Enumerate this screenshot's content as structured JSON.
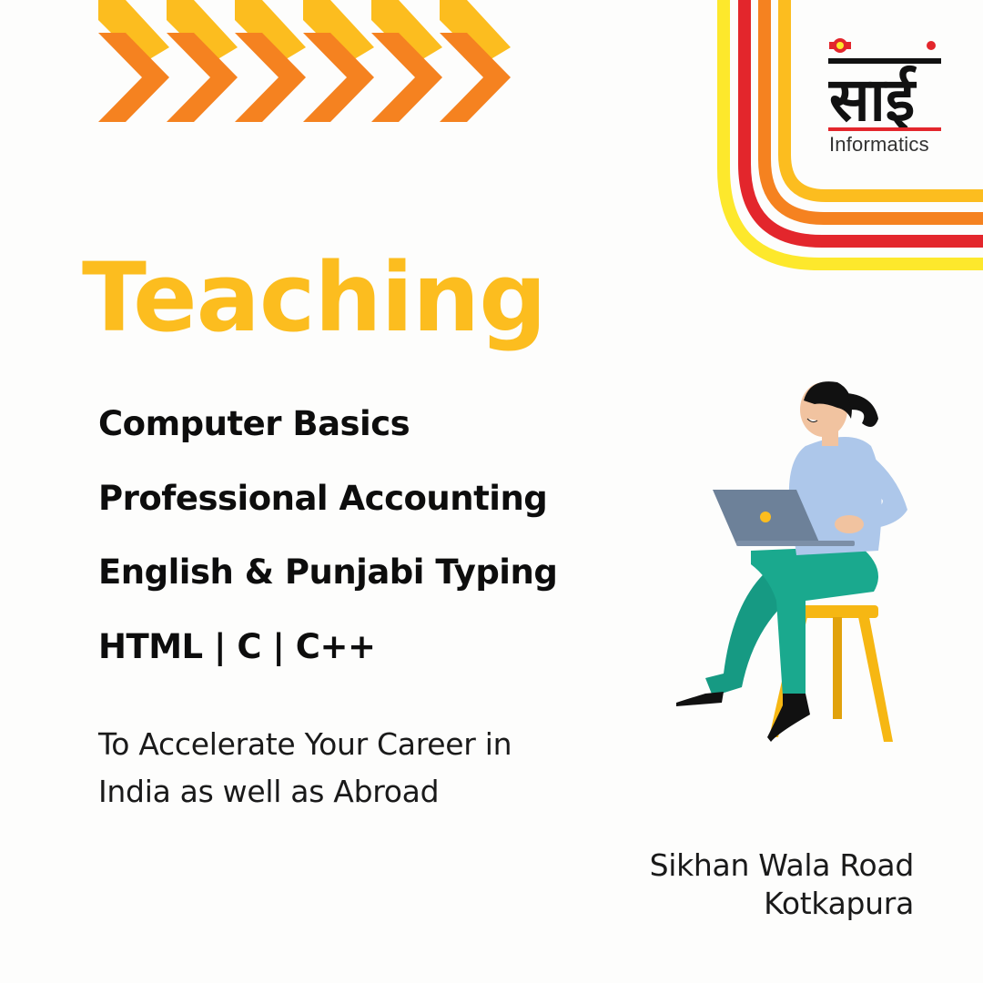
{
  "brand": {
    "logo_glyph": "साई",
    "name": "Informatics",
    "colors": {
      "red": "#e3262c",
      "orange": "#f58220",
      "yellow": "#fde82c"
    }
  },
  "heading": "Teaching",
  "courses": [
    "Computer Basics",
    "Professional Accounting",
    "English & Punjabi Typing",
    "HTML | C | C++"
  ],
  "tagline": [
    "To Accelerate Your Career in",
    "India as well as Abroad"
  ],
  "address": [
    "Sikhan Wala Road",
    "Kotkapura"
  ],
  "theme": {
    "heading_color": "#fcbd1f",
    "chevron_dark": "#f58220",
    "chevron_light": "#fcbd1f",
    "background": "#fdfdfc"
  },
  "illustration": "woman sitting on stool with laptop"
}
